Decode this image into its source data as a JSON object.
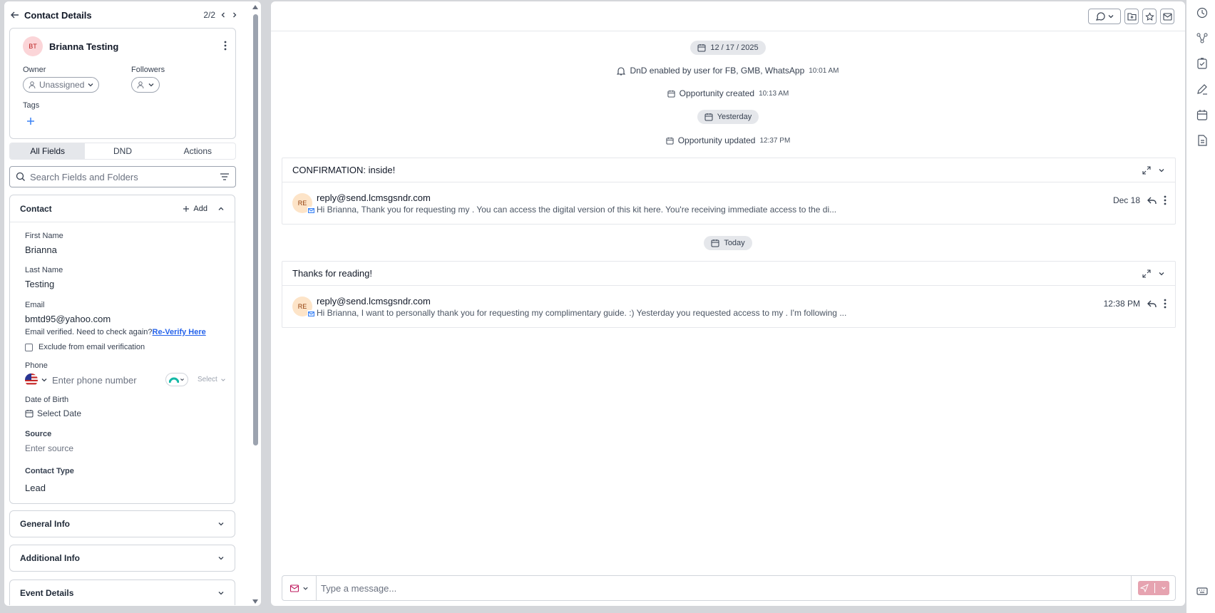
{
  "left": {
    "header": {
      "title": "Contact Details",
      "pager": "2/2"
    },
    "contact": {
      "initials": "BT",
      "name": "Brianna Testing",
      "owner_label": "Owner",
      "owner_value": "Unassigned",
      "followers_label": "Followers",
      "tags_label": "Tags"
    },
    "tabs": [
      {
        "label": "All Fields",
        "active": true
      },
      {
        "label": "DND",
        "active": false
      },
      {
        "label": "Actions",
        "active": false
      }
    ],
    "search": {
      "placeholder": "Search Fields and Folders"
    },
    "contact_section": {
      "title": "Contact",
      "add_label": "Add",
      "first_name_label": "First Name",
      "first_name": "Brianna",
      "last_name_label": "Last Name",
      "last_name": "Testing",
      "email_label": "Email",
      "email": "bmtd95@yahoo.com",
      "email_note": "Email verified. Need to check again?",
      "reverify_link": "Re-Verify Here",
      "exclude_label": "Exclude from email verification",
      "phone_label": "Phone",
      "phone_placeholder": "Enter phone number",
      "phone_select": "Select",
      "dob_label": "Date of Birth",
      "dob_placeholder": "Select Date",
      "source_label": "Source",
      "source_placeholder": "Enter source",
      "contact_type_label": "Contact Type",
      "contact_type": "Lead"
    },
    "collapsed_sections": [
      "General Info",
      "Additional Info",
      "Event Details"
    ]
  },
  "main": {
    "timeline": {
      "date_chip": "12 / 17 / 2025",
      "dnd_text": "DnD enabled by user for FB, GMB, WhatsApp",
      "dnd_time": "10:01 AM",
      "opp_created": "Opportunity created",
      "opp_created_time": "10:13 AM",
      "yesterday_chip": "Yesterday",
      "opp_updated": "Opportunity updated",
      "opp_updated_time": "12:37 PM",
      "today_chip": "Today"
    },
    "threads": [
      {
        "subject": "CONFIRMATION: inside!",
        "avatar": "RE",
        "sender": "reply@send.lcmsgsndr.com",
        "preview": "Hi Brianna, Thank you for requesting my . You can access the digital version of this kit here. You're receiving immediate access to the di...",
        "time": "Dec 18"
      },
      {
        "subject": "Thanks for reading!",
        "avatar": "RE",
        "sender": "reply@send.lcmsgsndr.com",
        "preview": "Hi Brianna, I want to personally thank you for requesting my complimentary guide. :) Yesterday you requested access to my . I'm following ...",
        "time": "12:38 PM"
      }
    ],
    "composer": {
      "placeholder": "Type a message..."
    }
  },
  "colors": {
    "accent": "#2563eb",
    "send": "#e6a3b0",
    "avatar_bt": "#fbd5d8",
    "avatar_re": "#fde4c8"
  }
}
